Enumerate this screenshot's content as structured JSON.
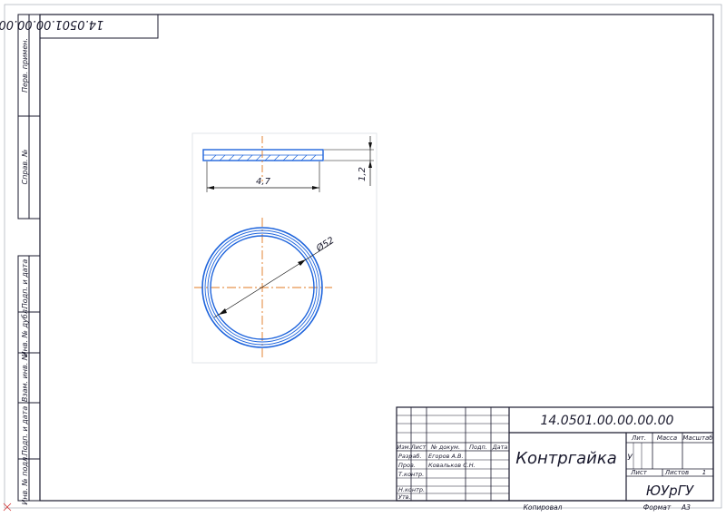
{
  "colors": {
    "frame": "#1a1a2e",
    "part": "#1e64dc",
    "centerline": "#e07820",
    "dimension": "#111111",
    "sheet": "#ffffff"
  },
  "top_stamp": "14.0501.00.00.00.00",
  "side_labels": [
    "Перв. примен.",
    "Справ. №",
    "Подп. и дата",
    "Инв. № дубл.",
    "Взам. инв. №",
    "Подп. и дата",
    "Инв. № подл."
  ],
  "dimensions": {
    "width": "4,7",
    "thickness": "1,2",
    "diameter": "Ø52"
  },
  "title_block": {
    "designation": "14.0501.00.00.00.00",
    "name": "Контргайка",
    "col_headers": [
      "Изм.",
      "Лист",
      "№ докум.",
      "Подп.",
      "Дата"
    ],
    "roles": [
      "Разраб.",
      "Пров.",
      "Т.контр.",
      "Н.контр.",
      "Утв."
    ],
    "people": [
      "Егоров А.В.",
      "Ковальков С.Н."
    ],
    "lit_label": "Лит.",
    "mass_label": "Масса",
    "scale_label": "Масштаб",
    "lit_value": "У",
    "sheet_label": "Лист",
    "sheets_label": "Листов",
    "sheets_value": "1",
    "org": "ЮУрГУ"
  },
  "footer": {
    "copied": "Копировал",
    "format": "Формат",
    "format_value": "А3"
  }
}
